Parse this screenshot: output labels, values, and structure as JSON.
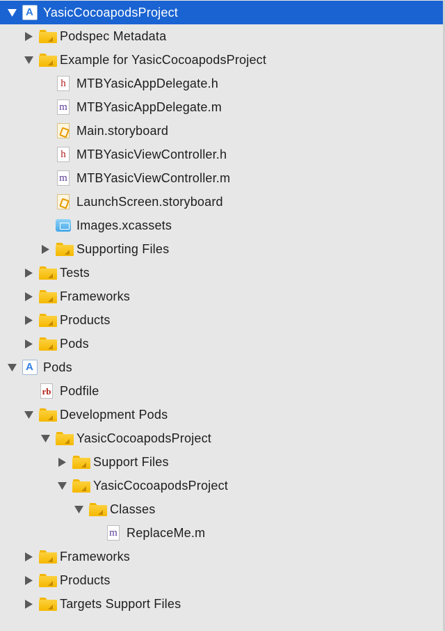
{
  "navigator": {
    "items": [
      {
        "label": "YasicCocoapodsProject",
        "icon": "project-icon",
        "kind": "project",
        "disclosure": "expanded",
        "depth": 0,
        "selected": true
      },
      {
        "label": "Podspec Metadata",
        "icon": "folder-icon",
        "kind": "folder",
        "disclosure": "collapsed",
        "depth": 1
      },
      {
        "label": "Example for YasicCocoapodsProject",
        "icon": "folder-icon",
        "kind": "folder",
        "disclosure": "expanded",
        "depth": 1
      },
      {
        "label": "MTBYasicAppDelegate.h",
        "icon": "header-file-icon",
        "kind": "h",
        "disclosure": "none",
        "depth": 2
      },
      {
        "label": "MTBYasicAppDelegate.m",
        "icon": "objc-file-icon",
        "kind": "m",
        "disclosure": "none",
        "depth": 2
      },
      {
        "label": "Main.storyboard",
        "icon": "storyboard-file-icon",
        "kind": "sb",
        "disclosure": "none",
        "depth": 2
      },
      {
        "label": "MTBYasicViewController.h",
        "icon": "header-file-icon",
        "kind": "h",
        "disclosure": "none",
        "depth": 2
      },
      {
        "label": "MTBYasicViewController.m",
        "icon": "objc-file-icon",
        "kind": "m",
        "disclosure": "none",
        "depth": 2
      },
      {
        "label": "LaunchScreen.storyboard",
        "icon": "storyboard-file-icon",
        "kind": "sb",
        "disclosure": "none",
        "depth": 2
      },
      {
        "label": "Images.xcassets",
        "icon": "asset-catalog-icon",
        "kind": "assets",
        "disclosure": "none",
        "depth": 2
      },
      {
        "label": "Supporting Files",
        "icon": "folder-icon",
        "kind": "folder",
        "disclosure": "collapsed",
        "depth": 2
      },
      {
        "label": "Tests",
        "icon": "folder-icon",
        "kind": "folder",
        "disclosure": "collapsed",
        "depth": 1
      },
      {
        "label": "Frameworks",
        "icon": "folder-icon",
        "kind": "folder",
        "disclosure": "collapsed",
        "depth": 1
      },
      {
        "label": "Products",
        "icon": "folder-icon",
        "kind": "folder",
        "disclosure": "collapsed",
        "depth": 1
      },
      {
        "label": "Pods",
        "icon": "folder-icon",
        "kind": "folder",
        "disclosure": "collapsed",
        "depth": 1
      },
      {
        "label": "Pods",
        "icon": "project-icon",
        "kind": "project",
        "disclosure": "expanded",
        "depth": 0
      },
      {
        "label": "Podfile",
        "icon": "ruby-file-icon",
        "kind": "rb",
        "disclosure": "none",
        "depth": 1
      },
      {
        "label": "Development Pods",
        "icon": "folder-icon",
        "kind": "folder",
        "disclosure": "expanded",
        "depth": 1
      },
      {
        "label": "YasicCocoapodsProject",
        "icon": "folder-icon",
        "kind": "folder",
        "disclosure": "expanded",
        "depth": 2
      },
      {
        "label": "Support Files",
        "icon": "folder-icon",
        "kind": "folder",
        "disclosure": "collapsed",
        "depth": 3
      },
      {
        "label": "YasicCocoapodsProject",
        "icon": "folder-icon",
        "kind": "folder",
        "disclosure": "expanded",
        "depth": 3
      },
      {
        "label": "Classes",
        "icon": "folder-icon",
        "kind": "folder",
        "disclosure": "expanded",
        "depth": 4
      },
      {
        "label": "ReplaceMe.m",
        "icon": "objc-file-icon",
        "kind": "m",
        "disclosure": "none",
        "depth": 5
      },
      {
        "label": "Frameworks",
        "icon": "folder-icon",
        "kind": "folder",
        "disclosure": "collapsed",
        "depth": 1
      },
      {
        "label": "Products",
        "icon": "folder-icon",
        "kind": "folder",
        "disclosure": "collapsed",
        "depth": 1
      },
      {
        "label": "Targets Support Files",
        "icon": "folder-icon",
        "kind": "folder",
        "disclosure": "collapsed",
        "depth": 1
      }
    ]
  },
  "colors": {
    "selection": "#1a63d2",
    "background": "#e7e7e7",
    "folder": "#f5b800"
  }
}
